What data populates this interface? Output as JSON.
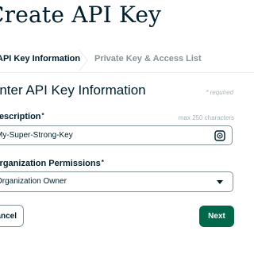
{
  "page": {
    "title": "Create API Key"
  },
  "tabs": [
    {
      "label": "API Key Information",
      "active": true
    },
    {
      "label": "Private Key & Access List",
      "active": false
    }
  ],
  "section": {
    "heading": "Enter API Key Information",
    "required_note": "* required"
  },
  "description_field": {
    "label": "Description",
    "required_mark": "*",
    "hint": "max 250 characters",
    "value": "My-Super-Strong-Key",
    "icon": "password-manager-icon"
  },
  "permissions_field": {
    "label": "Organization Permissions",
    "required_mark": "*",
    "selected": "Organization Owner",
    "icon": "caret-down-icon"
  },
  "actions": {
    "cancel_label": "Cancel",
    "next_label": "Next"
  },
  "colors": {
    "primary_button": "#00684a",
    "text_dark": "#001e2b",
    "text_muted": "#889397"
  }
}
